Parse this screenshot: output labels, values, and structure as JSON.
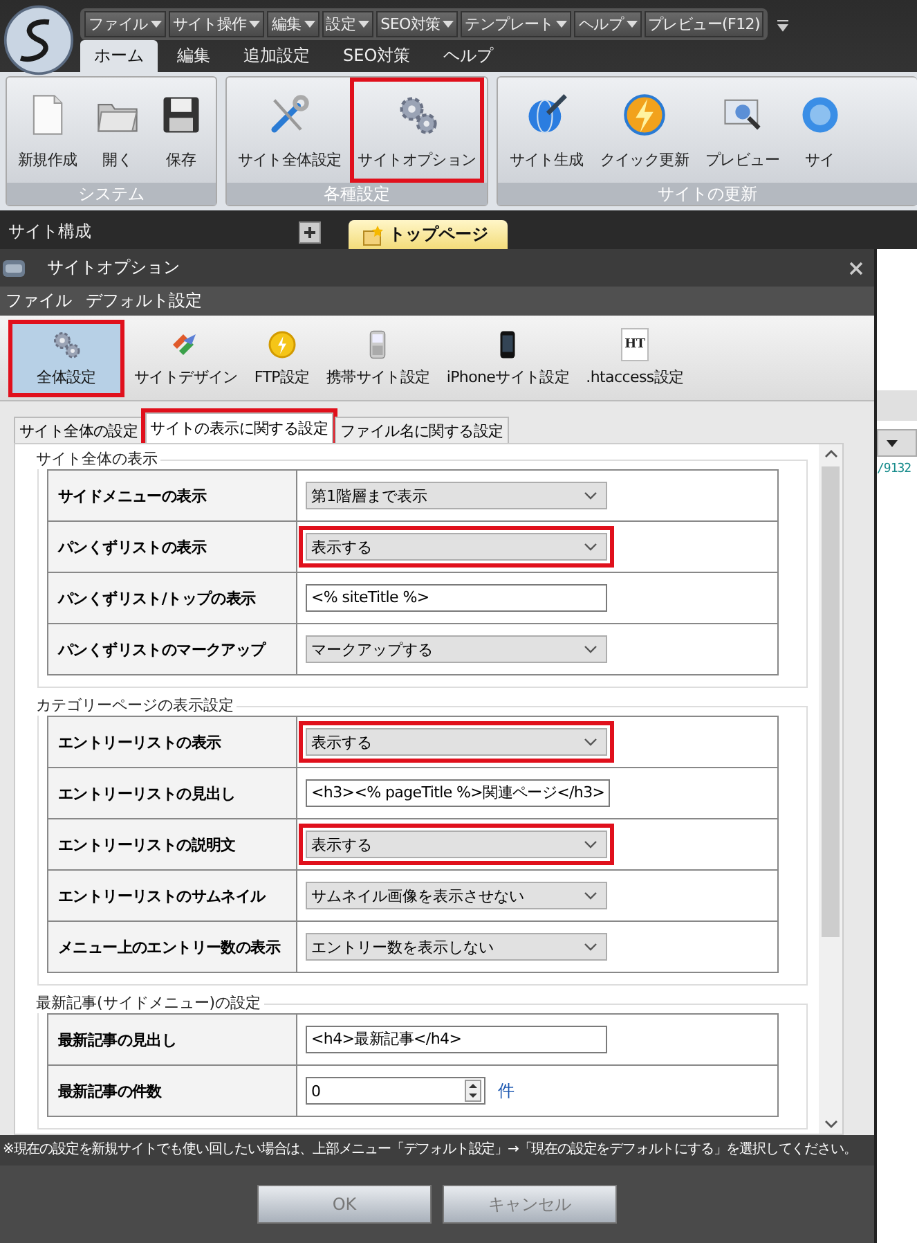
{
  "app": {
    "menu": [
      {
        "label": "ファイル",
        "dropdown": true
      },
      {
        "label": "サイト操作",
        "dropdown": true
      },
      {
        "label": "編集",
        "dropdown": true
      },
      {
        "label": "設定",
        "dropdown": true
      },
      {
        "label": "SEO対策",
        "dropdown": true
      },
      {
        "label": "テンプレート",
        "dropdown": true
      },
      {
        "label": "ヘルプ",
        "dropdown": true
      },
      {
        "label": "プレビュー(F12)",
        "dropdown": false
      }
    ],
    "ribbon_tabs": [
      {
        "label": "ホーム",
        "selected": true
      },
      {
        "label": "編集",
        "selected": false
      },
      {
        "label": "追加設定",
        "selected": false
      },
      {
        "label": "SEO対策",
        "selected": false
      },
      {
        "label": "ヘルプ",
        "selected": false
      }
    ],
    "ribbon_groups": [
      {
        "title": "システム",
        "buttons": [
          {
            "label": "新規作成",
            "highlighted": false
          },
          {
            "label": "開く",
            "highlighted": false
          },
          {
            "label": "保存",
            "highlighted": false
          }
        ]
      },
      {
        "title": "各種設定",
        "buttons": [
          {
            "label": "サイト全体設定",
            "highlighted": false
          },
          {
            "label": "サイトオプション",
            "highlighted": true
          }
        ]
      },
      {
        "title": "サイトの更新",
        "buttons": [
          {
            "label": "サイト生成",
            "highlighted": false
          },
          {
            "label": "クイック更新",
            "highlighted": false
          },
          {
            "label": "プレビュー",
            "highlighted": false
          },
          {
            "label": "サイ",
            "highlighted": false
          }
        ]
      }
    ],
    "panel_title": "サイト構成",
    "document_tab": "トップページ",
    "editor_fragment": "/9132"
  },
  "dialog": {
    "title": "サイトオプション",
    "menu": [
      "ファイル",
      "デフォルト設定"
    ],
    "toolbar": [
      {
        "label": "全体設定",
        "selected": true,
        "highlighted": true
      },
      {
        "label": "サイトデザイン",
        "selected": false,
        "highlighted": false
      },
      {
        "label": "FTP設定",
        "selected": false,
        "highlighted": false
      },
      {
        "label": "携帯サイト設定",
        "selected": false,
        "highlighted": false
      },
      {
        "label": "iPhoneサイト設定",
        "selected": false,
        "highlighted": false
      },
      {
        "label": ".htaccess設定",
        "icon_label": "HT",
        "selected": false,
        "highlighted": false
      }
    ],
    "tabs": [
      {
        "label": "サイト全体の設定",
        "selected": false,
        "highlighted": false
      },
      {
        "label": "サイトの表示に関する設定",
        "selected": true,
        "highlighted": true
      },
      {
        "label": "ファイル名に関する設定",
        "selected": false,
        "highlighted": false
      }
    ],
    "sections": [
      {
        "title": "サイト全体の表示",
        "rows": [
          {
            "label": "サイドメニューの表示",
            "kind": "select",
            "value": "第1階層まで表示",
            "highlighted": false
          },
          {
            "label": "パンくずリストの表示",
            "kind": "select",
            "value": "表示する",
            "highlighted": true
          },
          {
            "label": "パンくずリスト/トップの表示",
            "kind": "text",
            "value": "<% siteTitle %>",
            "highlighted": false
          },
          {
            "label": "パンくずリストのマークアップ",
            "kind": "select",
            "value": "マークアップする",
            "highlighted": false
          }
        ]
      },
      {
        "title": "カテゴリーページの表示設定",
        "rows": [
          {
            "label": "エントリーリストの表示",
            "kind": "select",
            "value": "表示する",
            "highlighted": true
          },
          {
            "label": "エントリーリストの見出し",
            "kind": "text",
            "value": "<h3><% pageTitle %>関連ページ</h3>",
            "highlighted": false
          },
          {
            "label": "エントリーリストの説明文",
            "kind": "select",
            "value": "表示する",
            "highlighted": true
          },
          {
            "label": "エントリーリストのサムネイル",
            "kind": "select",
            "value": "サムネイル画像を表示させない",
            "highlighted": false
          },
          {
            "label": "メニュー上のエントリー数の表示",
            "kind": "select",
            "value": "エントリー数を表示しない",
            "highlighted": false
          }
        ]
      },
      {
        "title": "最新記事(サイドメニュー)の設定",
        "rows": [
          {
            "label": "最新記事の見出し",
            "kind": "text",
            "value": "<h4>最新記事</h4>",
            "highlighted": false
          },
          {
            "label": "最新記事の件数",
            "kind": "spin",
            "value": "0",
            "unit": "件",
            "highlighted": false
          }
        ]
      }
    ],
    "note": "※現在の設定を新規サイトでも使い回したい場合は、上部メニュー「デフォルト設定」→「現在の設定をデフォルトにする」を選択してください。",
    "buttons": [
      "OK",
      "キャンセル"
    ]
  }
}
